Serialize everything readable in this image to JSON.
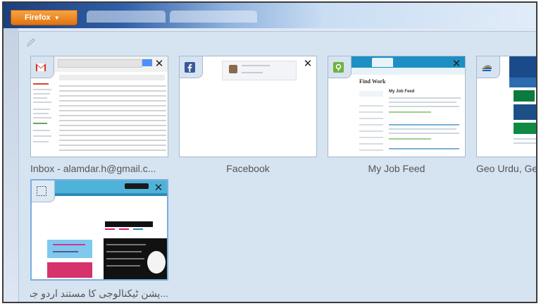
{
  "browser": {
    "firefox_button_label": "Firefox",
    "firefox_button_arrow": "▼",
    "accent_color": "#e2730f"
  },
  "panorama": {
    "background_color": "#d6e3f1",
    "tabs": [
      {
        "title": "Inbox - alamdar.h@gmail.c...",
        "icon": "gmail-icon",
        "close_glyph": "✕"
      },
      {
        "title": "Facebook",
        "icon": "facebook-icon",
        "close_glyph": "✕"
      },
      {
        "title": "My Job Feed",
        "icon": "odesk-icon",
        "close_glyph": "✕"
      },
      {
        "title": "Geo Urdu, Geo",
        "icon": "geo-news-icon"
      },
      {
        "title": "...پشن ٹیکنالوجی کا مستند اردو جریدہ",
        "icon": "blank-page-icon",
        "close_glyph": "✕"
      }
    ],
    "job_feed_thumb": {
      "heading": "Find Work",
      "section": "My Job Feed"
    }
  }
}
